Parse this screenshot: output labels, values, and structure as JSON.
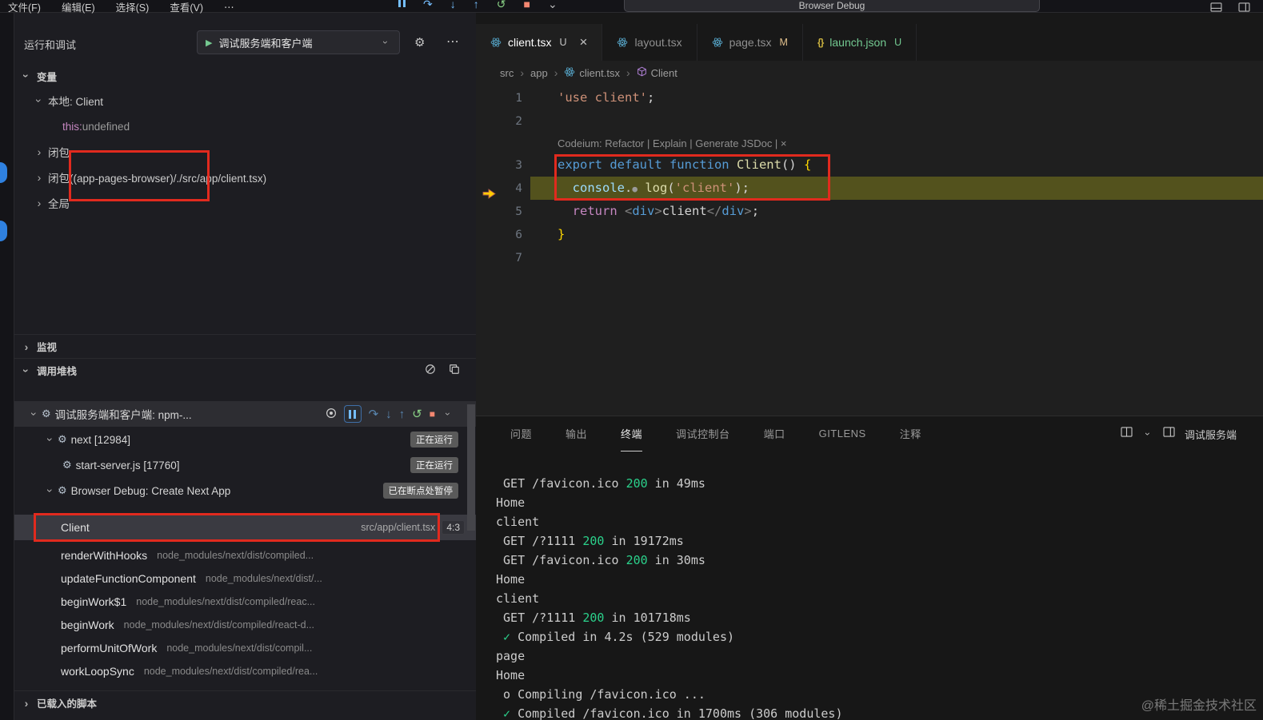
{
  "titlebar": {
    "menus": [
      "文件(F)",
      "编辑(E)",
      "选择(S)",
      "查看(V)",
      "⋯"
    ],
    "command_center": "Browser Debug"
  },
  "sidebar": {
    "title": "运行和调试",
    "config": {
      "name": "调试服务端和客户端"
    },
    "variables": {
      "header": "变量",
      "scopes": [
        {
          "label": "本地: Client",
          "expanded": true
        },
        {
          "label": "闭包",
          "expanded": false
        },
        {
          "label": "闭包((app-pages-browser)/./src/app/client.tsx)",
          "expanded": false
        },
        {
          "label": "全局",
          "expanded": false
        }
      ],
      "locals": [
        {
          "name": "this:",
          "value": "undefined"
        }
      ]
    },
    "watch": {
      "header": "监视"
    },
    "callstack": {
      "header": "调用堆栈",
      "rows": [
        {
          "kind": "session",
          "depth": 0,
          "label": "调试服务端和客户端: npm-...",
          "toolbar": true,
          "expanded": true
        },
        {
          "kind": "session",
          "depth": 1,
          "label": "next [12984]",
          "badge": "正在运行",
          "expanded": true
        },
        {
          "kind": "session",
          "depth": 2,
          "label": "start-server.js [17760]",
          "badge": "正在运行",
          "leaf": true
        },
        {
          "kind": "session",
          "depth": 1,
          "label": "Browser Debug: Create Next App",
          "badge": "已在断点处暂停",
          "expanded": true
        },
        {
          "kind": "frame",
          "label": "Client",
          "path": "src/app/client.tsx",
          "pos": "4:3",
          "selected": true
        },
        {
          "kind": "frame",
          "label": "renderWithHooks",
          "path": "node_modules/next/dist/compiled..."
        },
        {
          "kind": "frame",
          "label": "updateFunctionComponent",
          "path": "node_modules/next/dist/..."
        },
        {
          "kind": "frame",
          "label": "beginWork$1",
          "path": "node_modules/next/dist/compiled/reac..."
        },
        {
          "kind": "frame",
          "label": "beginWork",
          "path": "node_modules/next/dist/compiled/react-d..."
        },
        {
          "kind": "frame",
          "label": "performUnitOfWork",
          "path": "node_modules/next/dist/compil..."
        },
        {
          "kind": "frame",
          "label": "workLoopSync",
          "path": "node_modules/next/dist/compiled/rea..."
        }
      ]
    },
    "loaded_scripts": {
      "header": "已载入的脚本"
    }
  },
  "editor": {
    "tabs": [
      {
        "label": "client.tsx",
        "badge": "U",
        "active": true,
        "icon": "react"
      },
      {
        "label": "layout.tsx",
        "badge": "",
        "icon": "react"
      },
      {
        "label": "page.tsx",
        "badge": "M",
        "icon": "react"
      },
      {
        "label": "launch.json",
        "badge": "U",
        "icon": "braces",
        "git": "untracked"
      }
    ],
    "breadcrumb": [
      {
        "label": "src"
      },
      {
        "label": "app"
      },
      {
        "label": "client.tsx",
        "icon": "react"
      },
      {
        "label": "Client",
        "icon": "symbol"
      }
    ],
    "codelens": "Codeium: Refactor | Explain | Generate JSDoc | ×",
    "code": [
      {
        "num": "1",
        "tokens": [
          [
            "'use client'",
            "str"
          ],
          [
            ";",
            "pun"
          ]
        ]
      },
      {
        "num": "2",
        "tokens": []
      },
      {
        "num": "3",
        "tokens": [
          [
            "export default function ",
            "kw"
          ],
          [
            "Client",
            "fn"
          ],
          [
            "() ",
            "pun"
          ],
          [
            "{",
            "brace"
          ]
        ]
      },
      {
        "num": "4",
        "current": true,
        "tokens": [
          [
            "  ",
            "pun"
          ],
          [
            "console",
            "var"
          ],
          [
            ".",
            "pun"
          ],
          [
            "●",
            "dot"
          ],
          [
            " ",
            "pun"
          ],
          [
            "log",
            "fn"
          ],
          [
            "(",
            "pun"
          ],
          [
            "'client'",
            "str"
          ],
          [
            ")",
            "pun"
          ],
          [
            ";",
            "pun"
          ]
        ]
      },
      {
        "num": "5",
        "tokens": [
          [
            "  ",
            "pun"
          ],
          [
            "return ",
            "ctrl"
          ],
          [
            "<",
            "tagb"
          ],
          [
            "div",
            "tag"
          ],
          [
            ">",
            "tagb"
          ],
          [
            "client",
            "txt"
          ],
          [
            "</",
            "tagb"
          ],
          [
            "div",
            "tag"
          ],
          [
            ">",
            "tagb"
          ],
          [
            ";",
            "pun"
          ]
        ]
      },
      {
        "num": "6",
        "tokens": [
          [
            "}",
            "brace"
          ]
        ]
      },
      {
        "num": "7",
        "tokens": []
      }
    ]
  },
  "panel": {
    "tabs": [
      {
        "label": "问题"
      },
      {
        "label": "输出"
      },
      {
        "label": "终端",
        "active": true
      },
      {
        "label": "调试控制台"
      },
      {
        "label": "端口"
      },
      {
        "label": "GITLENS"
      },
      {
        "label": "注释"
      }
    ],
    "right_label": "调试服务端",
    "terminal": [
      [
        [
          " GET /favicon.ico ",
          "t"
        ],
        [
          "200",
          "ok"
        ],
        [
          " in 49ms",
          "t"
        ]
      ],
      [
        [
          "Home",
          "t"
        ]
      ],
      [
        [
          "client",
          "t"
        ]
      ],
      [
        [
          " GET /?1111 ",
          "t"
        ],
        [
          "200",
          "ok"
        ],
        [
          " in 19172ms",
          "t"
        ]
      ],
      [
        [
          " GET /favicon.ico ",
          "t"
        ],
        [
          "200",
          "ok"
        ],
        [
          " in 30ms",
          "t"
        ]
      ],
      [
        [
          "Home",
          "t"
        ]
      ],
      [
        [
          "client",
          "t"
        ]
      ],
      [
        [
          " GET /?1111 ",
          "t"
        ],
        [
          "200",
          "ok"
        ],
        [
          " in 101718ms",
          "t"
        ]
      ],
      [
        [
          " ✓",
          "ok"
        ],
        [
          " Compiled in 4.2s (529 modules)",
          "t"
        ]
      ],
      [
        [
          "page",
          "t"
        ]
      ],
      [
        [
          "Home",
          "t"
        ]
      ],
      [
        [
          " o Compiling /favicon.ico ...",
          "t"
        ]
      ],
      [
        [
          " ✓",
          "ok"
        ],
        [
          " Compiled /favicon.ico in 1700ms (306 modules)",
          "t"
        ]
      ]
    ]
  },
  "watermark": "@稀土掘金技术社区",
  "colors": {
    "annotation_red": "#e12a1e",
    "accent_blue": "#0078d4",
    "status_green": "#2bd18b",
    "modified_badge": "#e2c08d",
    "untracked_green": "#73c991",
    "current_line": "#53521d"
  }
}
